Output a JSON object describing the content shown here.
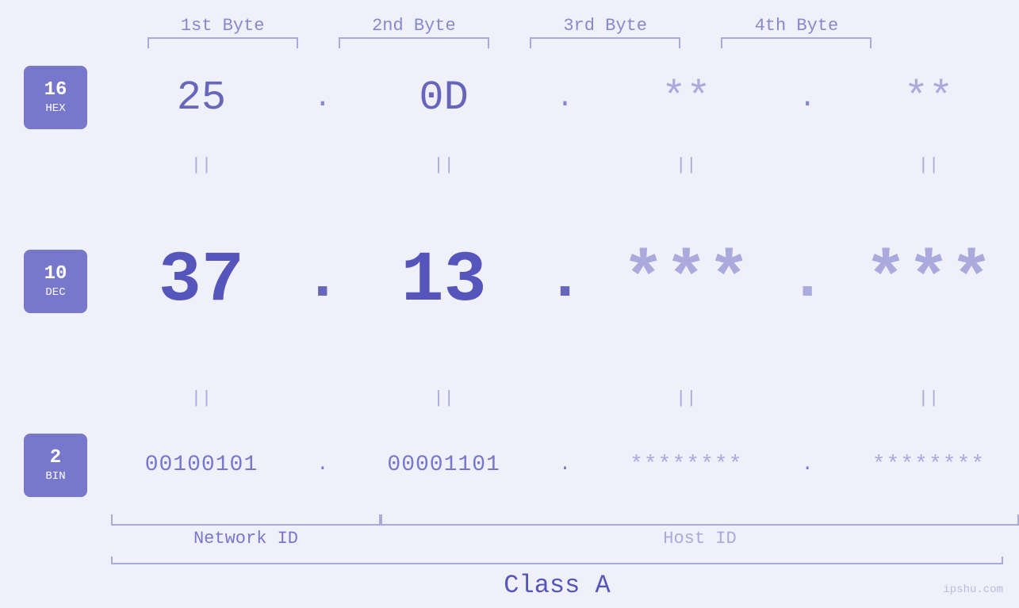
{
  "page": {
    "background_color": "#f0f0fa",
    "watermark": "ipshu.com"
  },
  "headers": {
    "byte1": "1st Byte",
    "byte2": "2nd Byte",
    "byte3": "3rd Byte",
    "byte4": "4th Byte"
  },
  "badges": {
    "hex": {
      "number": "16",
      "label": "HEX"
    },
    "dec": {
      "number": "10",
      "label": "DEC"
    },
    "bin": {
      "number": "2",
      "label": "BIN"
    }
  },
  "hex_row": {
    "byte1": "25",
    "byte2": "0D",
    "byte3": "**",
    "byte4": "**",
    "dots": [
      ".",
      ".",
      ".",
      "."
    ]
  },
  "dec_row": {
    "byte1": "37",
    "byte2": "13",
    "byte3": "***",
    "byte4": "***",
    "dots": [
      ".",
      ".",
      ".",
      "."
    ]
  },
  "bin_row": {
    "byte1": "00100101",
    "byte2": "00001101",
    "byte3": "********",
    "byte4": "********",
    "dots": [
      ".",
      ".",
      ".",
      "."
    ]
  },
  "labels": {
    "network_id": "Network ID",
    "host_id": "Host ID",
    "class": "Class A"
  },
  "separators": {
    "equals": "||"
  }
}
